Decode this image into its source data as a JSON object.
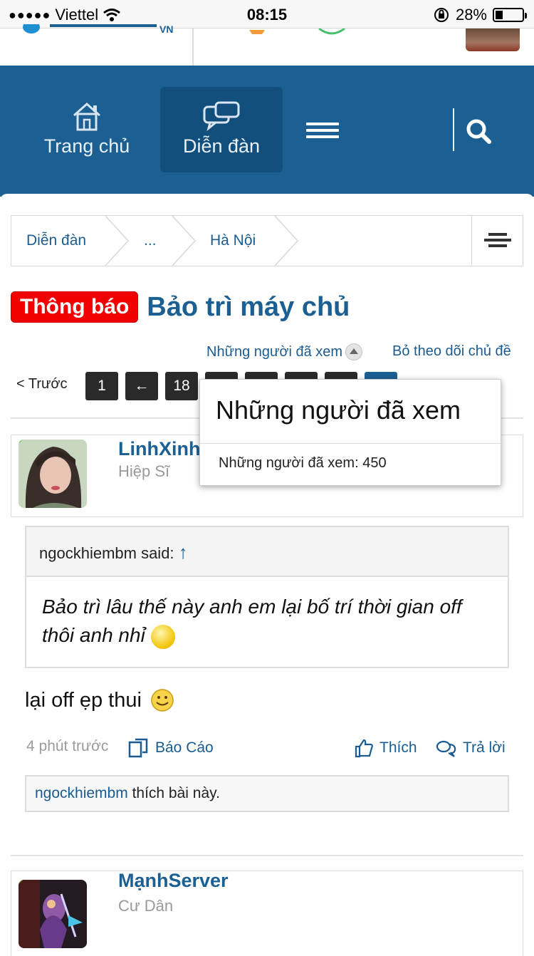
{
  "status_bar": {
    "carrier": "Viettel",
    "time": "08:15",
    "battery": "28%",
    "battery_level": 0.28
  },
  "nav": {
    "home_label": "Trang chủ",
    "forum_label": "Diễn đàn"
  },
  "breadcrumb": [
    "Diễn đàn",
    "...",
    "Hà Nội"
  ],
  "thread": {
    "prefix": "Thông báo",
    "title": "Bảo trì máy chủ",
    "viewed_link": "Những người đã xem",
    "unfollow": "Bỏ theo dõi chủ đề"
  },
  "pager": {
    "prev": "< Trước",
    "pages": [
      "1",
      "←",
      "18"
    ]
  },
  "popup": {
    "title": "Những người đã xem",
    "body": "Những người đã xem: 450"
  },
  "posts": [
    {
      "username": "LinhXinh",
      "rank": "Hiệp Sĩ",
      "quote_author": "ngockhiembm said:",
      "quote_arrow": "↑",
      "quote_text": "Bảo trì lâu thế này anh em lại bố trí thời gian off thôi anh nhỉ",
      "message": "lại off ẹp thui",
      "time": "4 phút trước",
      "report": "Báo Cáo",
      "like": "Thích",
      "reply": "Trả lời",
      "liker": "ngockhiembm",
      "likes_suffix": " thích bài này."
    },
    {
      "username": "MạnhServer",
      "rank": "Cư Dân"
    }
  ],
  "colors": {
    "primary": "#1b5f93",
    "badge": "#f20000",
    "link": "#1a5c91"
  }
}
